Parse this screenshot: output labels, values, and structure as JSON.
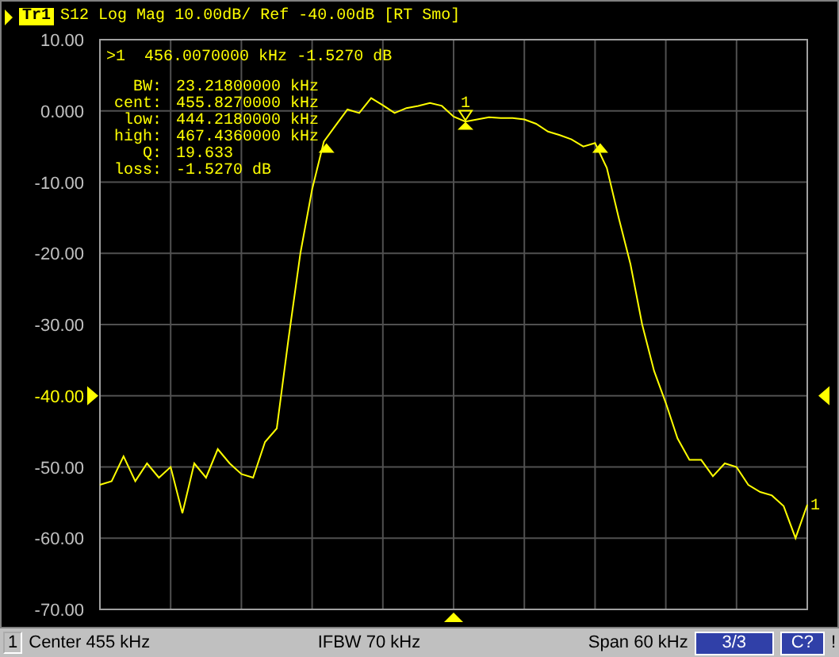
{
  "trace_header": {
    "trace_label": "Tr1",
    "selected": true,
    "parameter": "S12",
    "format": "Log Mag",
    "scale": "10.00dB/",
    "reference": "Ref -40.00dB",
    "options": "[RT Smo]"
  },
  "marker_readout": {
    "active_marker": ">1",
    "stimulus": "456.0070000 kHz",
    "response": "-1.5270 dB"
  },
  "bandwidth_stats": [
    {
      "label": "BW:",
      "value": "23.21800000 kHz"
    },
    {
      "label": "cent:",
      "value": "455.8270000 kHz"
    },
    {
      "label": "low:",
      "value": "444.2180000 kHz"
    },
    {
      "label": "high:",
      "value": "467.4360000 kHz"
    },
    {
      "label": "Q:",
      "value": "19.633"
    },
    {
      "label": "loss:",
      "value": "-1.5270 dB"
    }
  ],
  "plot": {
    "trace_end_label": "1",
    "marker_label": "1",
    "chart_data": {
      "type": "line",
      "grid": true,
      "ylim": [
        -70,
        10
      ],
      "yticks": [
        {
          "value": 10,
          "label": "10.00"
        },
        {
          "value": 0,
          "label": "0.000"
        },
        {
          "value": -10,
          "label": "-10.00"
        },
        {
          "value": -20,
          "label": "-20.00"
        },
        {
          "value": -30,
          "label": "-30.00"
        },
        {
          "value": -40,
          "label": "-40.00"
        },
        {
          "value": -50,
          "label": "-50.00"
        },
        {
          "value": -60,
          "label": "-60.00"
        },
        {
          "value": -70,
          "label": "-70.00"
        }
      ],
      "categories": [
        null,
        null,
        null,
        null,
        null,
        null,
        null,
        null,
        null,
        null,
        null,
        null,
        null,
        null,
        null,
        null,
        null,
        null,
        null,
        null,
        null,
        null,
        null,
        null,
        null,
        null,
        null,
        null,
        null,
        null,
        null,
        null,
        null,
        null,
        null,
        null,
        null,
        null,
        null,
        null,
        null,
        null,
        null,
        null,
        null,
        null,
        null,
        null,
        null,
        null,
        null,
        null,
        null,
        null,
        null,
        null,
        null,
        null,
        null,
        null,
        null
      ],
      "series": [
        {
          "color": "#ffff00",
          "values": [
            -52.5,
            -52,
            -48.5,
            -52,
            -49.5,
            -51.5,
            -50,
            -56.5,
            -49.5,
            -51.5,
            -47.5,
            -49.5,
            -51,
            -51.5,
            -46.5,
            -44.6,
            -32,
            -20,
            -11,
            -4.3,
            -2,
            0.2,
            -0.3,
            1.8,
            0.8,
            -0.3,
            0.4,
            0.7,
            1.1,
            0.7,
            -0.8,
            -1.5,
            -1.2,
            -0.9,
            -1,
            -1,
            -1.2,
            -1.8,
            -2.9,
            -3.4,
            -4,
            -5,
            -4.5,
            -8,
            -15,
            -21.5,
            -30,
            -36.5,
            -41,
            -46,
            -49,
            -49,
            -51.3,
            -49.5,
            -50,
            -52.5,
            -53.5,
            -54,
            -55.5,
            -60,
            -55.3
          ]
        }
      ]
    }
  },
  "status_bar": {
    "channel": "1",
    "center": {
      "label": "Center",
      "value": "455 kHz"
    },
    "ifbw": "IFBW 70 kHz",
    "span": {
      "label": "Span",
      "value": "60 kHz"
    },
    "indicators": [
      {
        "text": "3/3"
      },
      {
        "text": "C?"
      }
    ],
    "alert": "!"
  }
}
